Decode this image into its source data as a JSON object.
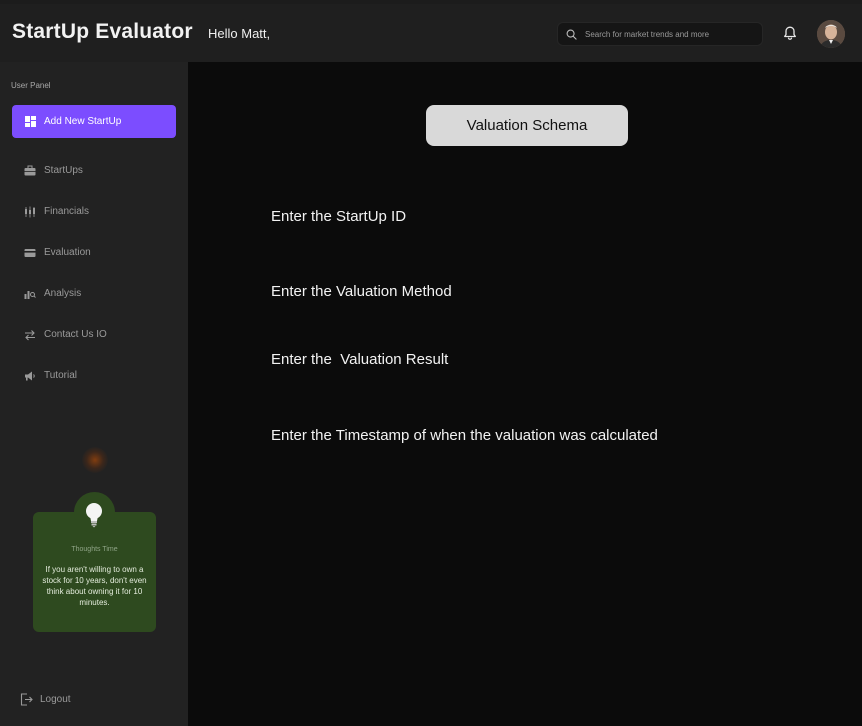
{
  "header": {
    "app_title": "StartUp Evaluator",
    "greeting": "Hello Matt,",
    "search_placeholder": "Search for market trends and more",
    "icons": [
      "search-icon",
      "bell-icon",
      "avatar"
    ]
  },
  "sidebar": {
    "panel_label": "User Panel",
    "items": [
      {
        "label": "Add New StartUp",
        "icon": "dashboard-icon",
        "active": true
      },
      {
        "label": "StartUps",
        "icon": "briefcase-icon",
        "active": false
      },
      {
        "label": "Financials",
        "icon": "candlestick-icon",
        "active": false
      },
      {
        "label": "Evaluation",
        "icon": "card-icon",
        "active": false
      },
      {
        "label": "Analysis",
        "icon": "analysis-icon",
        "active": false
      },
      {
        "label": "Contact Us IO",
        "icon": "swap-arrows-icon",
        "active": false
      },
      {
        "label": "Tutorial",
        "icon": "megaphone-icon",
        "active": false
      }
    ],
    "thought": {
      "title": "Thoughts Time",
      "text": "If you aren't willing to own a stock for 10 years, don't even think about owning it for 10 minutes."
    },
    "logout_label": "Logout"
  },
  "main": {
    "schema_button": "Valuation Schema",
    "fields": [
      "Enter the StartUp ID",
      "Enter the Valuation Method",
      "Enter the  Valuation Result",
      "Enter the Timestamp of when the valuation was calculated"
    ]
  },
  "colors": {
    "accent": "#7c4dff",
    "card_green": "#2e4a1f",
    "main_bg": "#0b0b0b",
    "sidebar_bg": "#222222"
  }
}
